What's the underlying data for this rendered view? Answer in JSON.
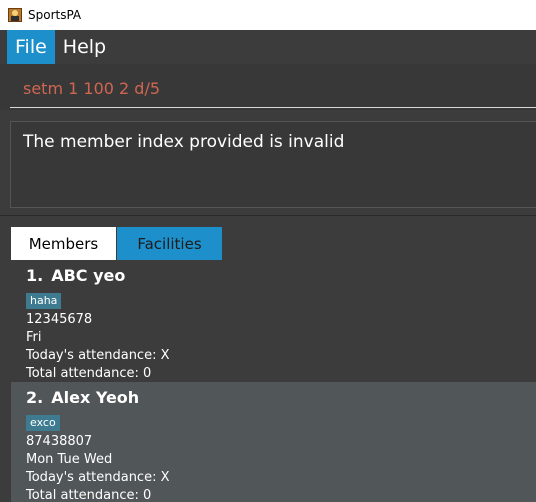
{
  "window": {
    "title": "SportsPA"
  },
  "menu": {
    "items": [
      "File",
      "Help"
    ]
  },
  "command": {
    "value": "setm 1 100 2 d/5"
  },
  "result": {
    "message": "The member index provided is invalid"
  },
  "tabs": [
    "Members",
    "Facilities"
  ],
  "members": [
    {
      "index": "1.",
      "name": "ABC yeo",
      "tag": "haha",
      "phone": "12345678",
      "days": "Fri",
      "today": "Today's attendance: X",
      "total": "Total attendance: 0"
    },
    {
      "index": "2.",
      "name": "Alex Yeoh",
      "tag": "exco",
      "phone": "87438807",
      "days": "Mon Tue Wed",
      "today": "Today's attendance: X",
      "total": "Total attendance: 0"
    }
  ],
  "colors": {
    "accent": "#1d8fcb",
    "command_text": "#d06651",
    "tag_bg": "#3e7b91",
    "selected_row": "#515658"
  },
  "icons": {
    "app": "sportspa-app-icon"
  }
}
